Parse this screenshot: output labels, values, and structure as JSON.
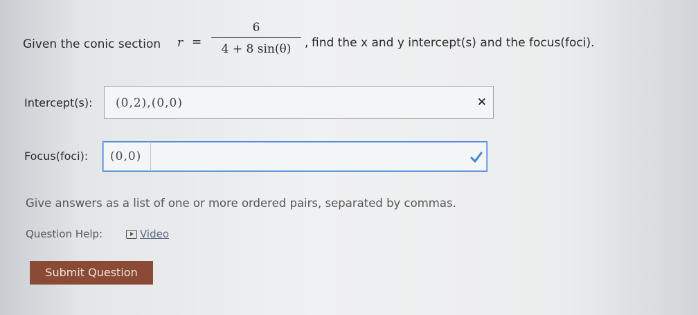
{
  "question": {
    "prefix": "Given the conic section",
    "r_label": "r",
    "equals": "=",
    "numerator": "6",
    "denominator": "4 + 8 sin(θ)",
    "suffix_comma": ",",
    "suffix": "find the x and y intercept(s) and the focus(foci)."
  },
  "intercepts": {
    "label": "Intercept(s):",
    "value": "(0,2),(0,0)",
    "status_icon": "x-mark"
  },
  "focus": {
    "label": "Focus(foci):",
    "value": "(0,0)",
    "status_icon": "checkmark"
  },
  "instructions": "Give answers as a list of one or more ordered pairs, separated by commas.",
  "help": {
    "label": "Question Help:",
    "video_label": "Video"
  },
  "submit_label": "Submit Question"
}
